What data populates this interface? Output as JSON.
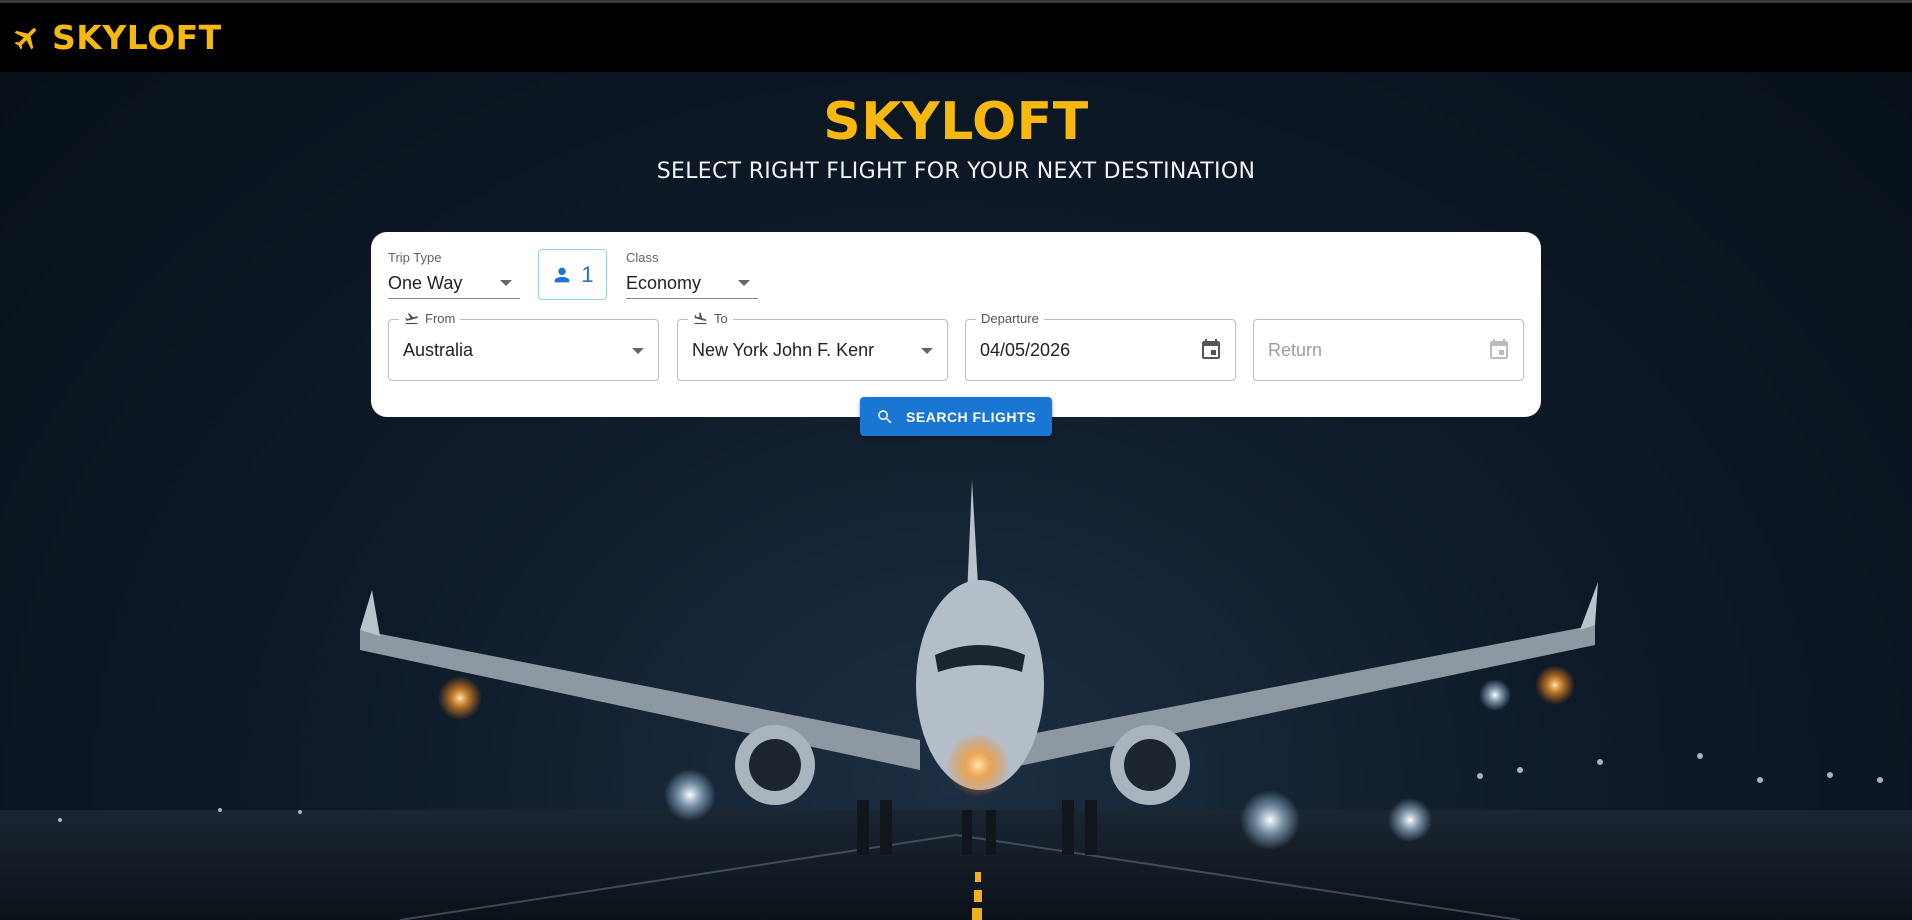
{
  "nav": {
    "brand": "SKYLOFT",
    "brand_icon": "airplane-icon",
    "accent_color": "#f5b80f"
  },
  "hero": {
    "title": "SKYLOFT",
    "subtitle": "SELECT RIGHT FLIGHT FOR YOUR NEXT DESTINATION"
  },
  "search": {
    "trip_type": {
      "label": "Trip Type",
      "value": "One Way"
    },
    "passengers": {
      "value": "1",
      "icon": "person-icon"
    },
    "class": {
      "label": "Class",
      "value": "Economy"
    },
    "from": {
      "label": "From",
      "value": "Australia",
      "icon": "flight-takeoff-icon"
    },
    "to": {
      "label": "To",
      "value": "New York John F. Kenr",
      "icon": "flight-land-icon"
    },
    "departure": {
      "label": "Departure",
      "value": "04/05/2026",
      "icon": "calendar-icon"
    },
    "return": {
      "placeholder": "Return",
      "icon": "calendar-icon"
    },
    "button": {
      "label": "SEARCH FLIGHTS",
      "icon": "search-icon",
      "color": "#1976d2"
    }
  }
}
